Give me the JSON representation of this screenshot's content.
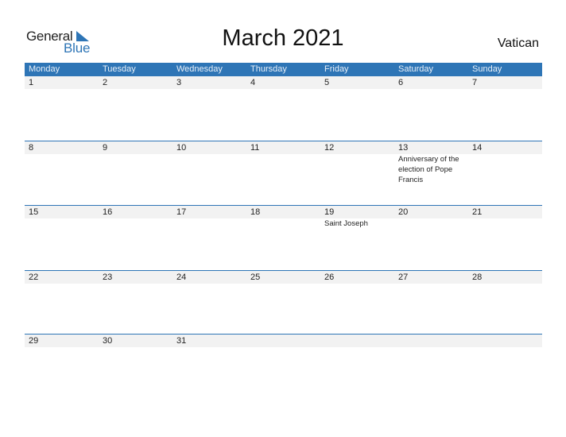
{
  "logo": {
    "line1": "General",
    "line2": "Blue"
  },
  "title": "March 2021",
  "country": "Vatican",
  "colors": {
    "accent": "#2e75b6",
    "band": "#f2f2f2"
  },
  "weekdays": [
    "Monday",
    "Tuesday",
    "Wednesday",
    "Thursday",
    "Friday",
    "Saturday",
    "Sunday"
  ],
  "weeks": [
    {
      "days": [
        {
          "num": "1",
          "event": ""
        },
        {
          "num": "2",
          "event": ""
        },
        {
          "num": "3",
          "event": ""
        },
        {
          "num": "4",
          "event": ""
        },
        {
          "num": "5",
          "event": ""
        },
        {
          "num": "6",
          "event": ""
        },
        {
          "num": "7",
          "event": ""
        }
      ]
    },
    {
      "days": [
        {
          "num": "8",
          "event": ""
        },
        {
          "num": "9",
          "event": ""
        },
        {
          "num": "10",
          "event": ""
        },
        {
          "num": "11",
          "event": ""
        },
        {
          "num": "12",
          "event": ""
        },
        {
          "num": "13",
          "event": "Anniversary of the election of Pope Francis"
        },
        {
          "num": "14",
          "event": ""
        }
      ]
    },
    {
      "days": [
        {
          "num": "15",
          "event": ""
        },
        {
          "num": "16",
          "event": ""
        },
        {
          "num": "17",
          "event": ""
        },
        {
          "num": "18",
          "event": ""
        },
        {
          "num": "19",
          "event": "Saint Joseph"
        },
        {
          "num": "20",
          "event": ""
        },
        {
          "num": "21",
          "event": ""
        }
      ]
    },
    {
      "days": [
        {
          "num": "22",
          "event": ""
        },
        {
          "num": "23",
          "event": ""
        },
        {
          "num": "24",
          "event": ""
        },
        {
          "num": "25",
          "event": ""
        },
        {
          "num": "26",
          "event": ""
        },
        {
          "num": "27",
          "event": ""
        },
        {
          "num": "28",
          "event": ""
        }
      ]
    },
    {
      "days": [
        {
          "num": "29",
          "event": ""
        },
        {
          "num": "30",
          "event": ""
        },
        {
          "num": "31",
          "event": ""
        },
        {
          "num": "",
          "event": ""
        },
        {
          "num": "",
          "event": ""
        },
        {
          "num": "",
          "event": ""
        },
        {
          "num": "",
          "event": ""
        }
      ]
    }
  ]
}
